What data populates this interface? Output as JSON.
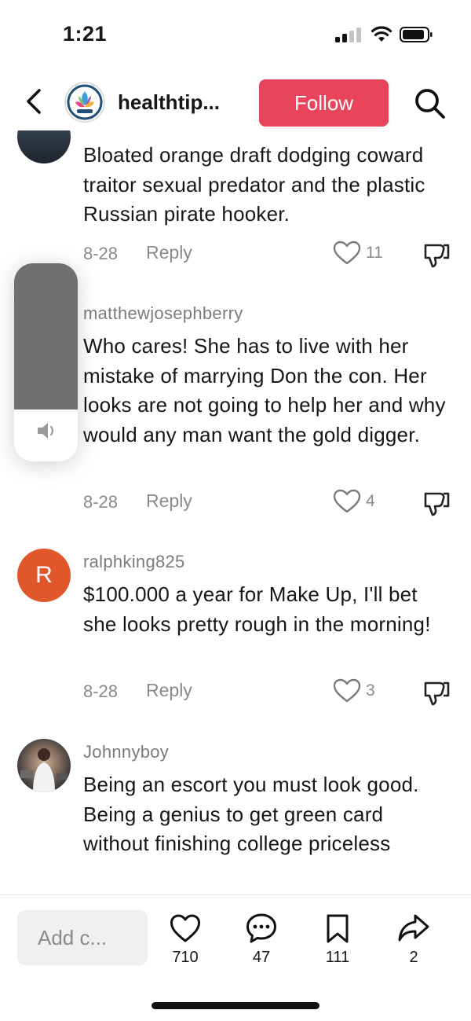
{
  "status_bar": {
    "time": "1:21"
  },
  "header": {
    "account_name": "healthtip...",
    "follow_label": "Follow"
  },
  "comments": [
    {
      "username": "",
      "text": "Bloated orange draft dodging coward traitor sexual predator and the plastic Russian pirate hooker.",
      "date": "8-28",
      "reply_label": "Reply",
      "likes": "11"
    },
    {
      "username": "matthewjosephberry",
      "text": "Who cares! She has to live with her mistake of marrying Don the con. Her looks are not going to help her and why would any man want the gold digger.",
      "date": "8-28",
      "reply_label": "Reply",
      "likes": "4"
    },
    {
      "username": "ralphking825",
      "avatar_letter": "R",
      "avatar_color": "#e0572b",
      "text": "$100.000 a year for Make Up, I'll bet she looks pretty rough in the morning!",
      "date": "8-28",
      "reply_label": "Reply",
      "likes": "3"
    },
    {
      "username": "Johnnyboy",
      "text": "Being an escort you must look good. Being a genius to get green card without finishing college priceless"
    }
  ],
  "volume": {
    "level": 0.74,
    "icon": "speaker-icon"
  },
  "bottom_bar": {
    "input_placeholder": "Add c...",
    "like_count": "710",
    "comment_count": "47",
    "bookmark_count": "111",
    "share_count": "2"
  },
  "colors": {
    "follow": "#e8455c",
    "avatar_r": "#e0572b",
    "muted_text": "#8a8a8a"
  }
}
